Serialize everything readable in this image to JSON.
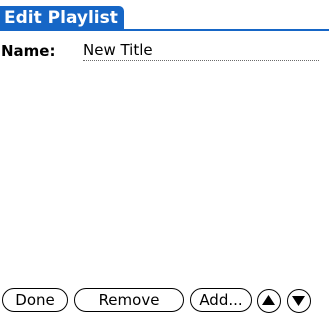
{
  "title_bar": {
    "title": "Edit Playlist",
    "accent_color": "#1666c6"
  },
  "name_row": {
    "label": "Name:",
    "value": "New Title"
  },
  "buttons": {
    "done_label": "Done",
    "remove_label": "Remove",
    "add_label": "Add..."
  },
  "icons": {
    "scroll_up": "triangle-up-icon",
    "scroll_down": "triangle-down-icon"
  }
}
